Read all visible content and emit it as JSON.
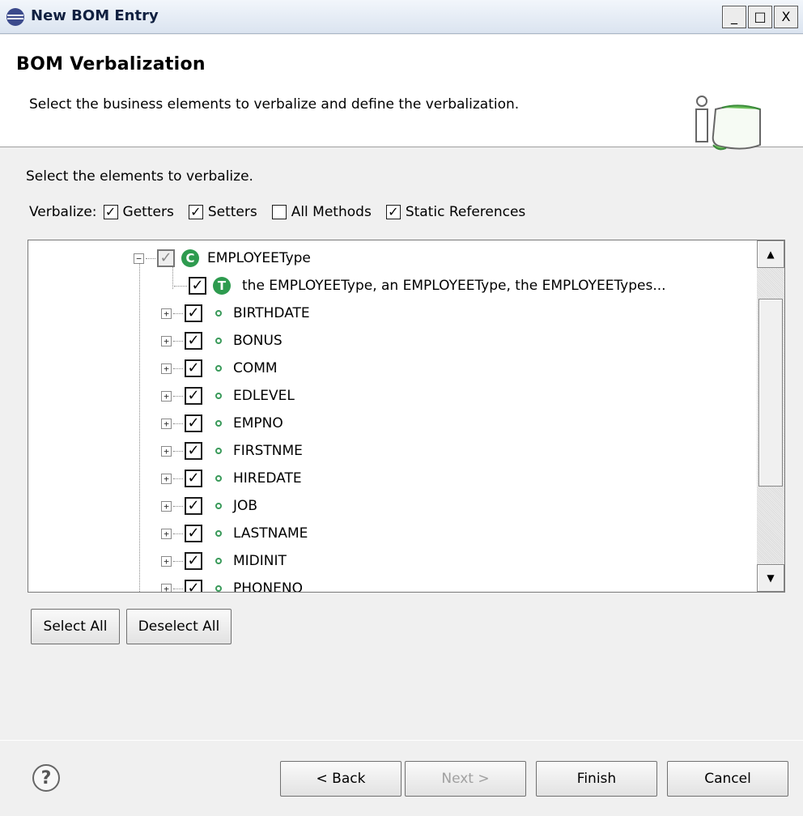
{
  "window": {
    "title": "New BOM Entry",
    "minimize": "_",
    "maximize": "□",
    "close": "X"
  },
  "header": {
    "title": "BOM Verbalization",
    "description": "Select the business elements to verbalize and define the verbalization."
  },
  "select_label": "Select the elements to verbalize.",
  "verbalize": {
    "label": "Verbalize:",
    "options": [
      {
        "label": "Getters",
        "checked": true
      },
      {
        "label": "Setters",
        "checked": true
      },
      {
        "label": "All Methods",
        "checked": false
      },
      {
        "label": "Static References",
        "checked": true
      }
    ]
  },
  "tree": {
    "root": {
      "label": "EMPLOYEEType",
      "icon": "class-icon",
      "checked": "partial"
    },
    "term": {
      "label": "the EMPLOYEEType, an EMPLOYEEType, the EMPLOYEETypes...",
      "icon": "term-icon",
      "checked": true
    },
    "fields": [
      "BIRTHDATE",
      "BONUS",
      "COMM",
      "EDLEVEL",
      "EMPNO",
      "FIRSTNME",
      "HIREDATE",
      "JOB",
      "LASTNAME",
      "MIDINIT",
      "PHONENO"
    ]
  },
  "buttons": {
    "select_all": "Select All",
    "deselect_all": "Deselect All",
    "back": "< Back",
    "next": "Next >",
    "finish": "Finish",
    "cancel": "Cancel"
  },
  "help": "?",
  "check_mark": "✓",
  "colors": {
    "class_icon": "#2e9b4f",
    "field_icon": "#3a9a5a"
  }
}
